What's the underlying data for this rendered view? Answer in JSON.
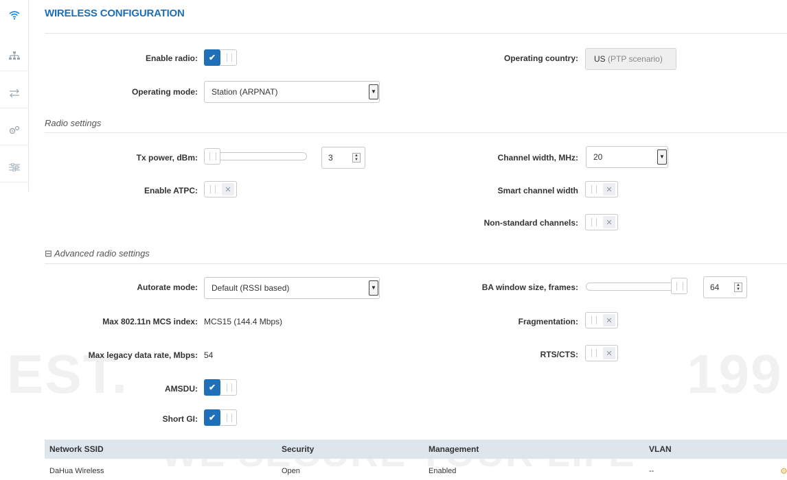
{
  "header": {
    "title": "WIRELESS CONFIGURATION"
  },
  "sidebar": {
    "icons": [
      "wifi-icon",
      "network-icon",
      "arrows-icon",
      "gears-icon",
      "sliders-icon"
    ]
  },
  "main": {
    "enable_radio": {
      "label": "Enable radio:",
      "state": "on"
    },
    "operating_country": {
      "label": "Operating country:",
      "value": "US",
      "sub": "(PTP scenario)"
    },
    "operating_mode": {
      "label": "Operating mode:",
      "value": "Station (ARPNAT)"
    }
  },
  "radio_settings": {
    "title": "Radio settings",
    "tx_power": {
      "label": "Tx power, dBm:",
      "value": "3"
    },
    "channel_width": {
      "label": "Channel width, MHz:",
      "value": "20"
    },
    "enable_atpc": {
      "label": "Enable ATPC:",
      "state": "off"
    },
    "smart_channel_width": {
      "label": "Smart channel width",
      "state": "off"
    },
    "non_standard_channels": {
      "label": "Non-standard channels:",
      "state": "off"
    }
  },
  "advanced": {
    "title": "Advanced radio settings",
    "expander_glyph": "⊟",
    "autorate_mode": {
      "label": "Autorate mode:",
      "value": "Default (RSSI based)"
    },
    "ba_window": {
      "label": "BA window size, frames:",
      "value": "64"
    },
    "max_mcs": {
      "label": "Max 802.11n MCS index:",
      "value": "MCS15 (144.4 Mbps)"
    },
    "fragmentation": {
      "label": "Fragmentation:",
      "state": "off"
    },
    "max_legacy": {
      "label": "Max legacy data rate, Mbps:",
      "value": "54"
    },
    "rts_cts": {
      "label": "RTS/CTS:",
      "state": "off"
    },
    "amsdu": {
      "label": "AMSDU:",
      "state": "on"
    },
    "short_gi": {
      "label": "Short GI:",
      "state": "on"
    }
  },
  "table": {
    "headers": [
      "Network SSID",
      "Security",
      "Management",
      "VLAN"
    ],
    "rows": [
      {
        "ssid": "DaHua Wireless",
        "security": "Open",
        "management": "Enabled",
        "vlan": "--"
      }
    ]
  },
  "watermark": {
    "line1": "WE SECURE YOUR LIFE",
    "left": "EST.",
    "right": "199"
  },
  "colors": {
    "accent": "#1a6fb5",
    "toggle_on": "#1f6fb9",
    "table_header": "#dde5ed"
  }
}
